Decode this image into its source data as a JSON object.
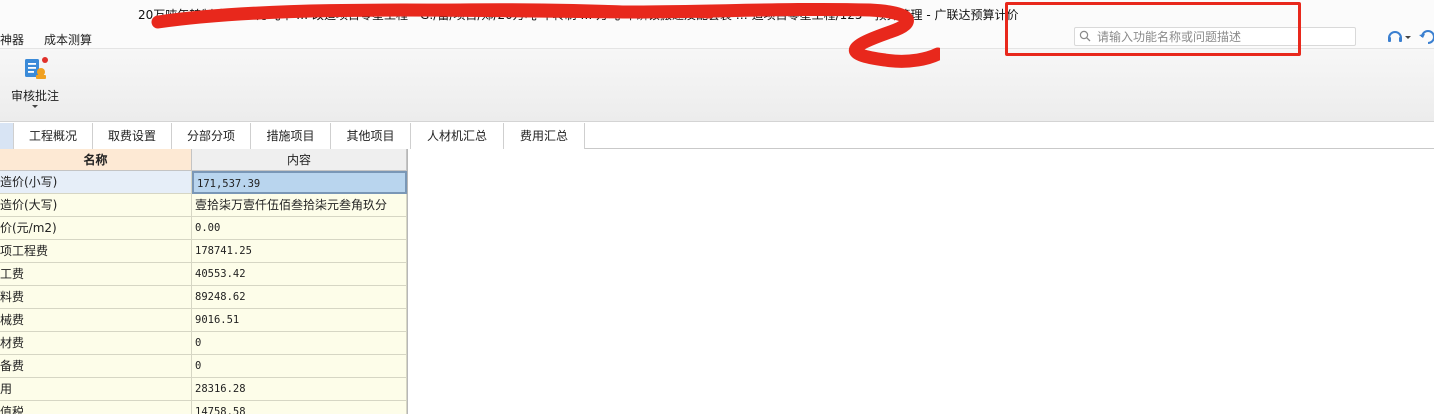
{
  "window": {
    "title": "20万吨年转制磷酸 65万吨年 … 改造项目零星工程 - G:/蕾/项目/郑/20万吨 年转制 … 万吨  年磷铵搬迁及配套装 … 造项目零星工程/125 - 预算管理 - 广联达预算计价"
  },
  "menu": {
    "items": [
      "神器",
      "成本测算"
    ]
  },
  "search": {
    "placeholder": "请输入功能名称或问题描述"
  },
  "toolbar": {
    "review_label": "审核批注"
  },
  "tabs": [
    "工程概况",
    "取费设置",
    "分部分项",
    "措施项目",
    "其他项目",
    "人材机汇总",
    "费用汇总"
  ],
  "grid": {
    "headers": {
      "name": "名称",
      "value": "内容"
    },
    "rows": [
      {
        "name": "造价(小写)",
        "value": "171,537.39"
      },
      {
        "name": "造价(大写)",
        "value": "壹拾柒万壹仟伍佰叁拾柒元叁角玖分"
      },
      {
        "name": "价(元/m2)",
        "value": "0.00"
      },
      {
        "name": "项工程费",
        "value": "178741.25"
      },
      {
        "name": "工费",
        "value": "40553.42"
      },
      {
        "name": "料费",
        "value": "89248.62"
      },
      {
        "name": "械费",
        "value": "9016.51"
      },
      {
        "name": "材费",
        "value": "0"
      },
      {
        "name": "备费",
        "value": "0"
      },
      {
        "name": "用",
        "value": "28316.28"
      },
      {
        "name": "值税",
        "value": "14758.58"
      }
    ]
  },
  "colors": {
    "annotation_red": "#e8281c",
    "selection": "#b9d5ee",
    "header_name_bg": "#fde9d4",
    "cell_bg": "#fdfde9"
  }
}
